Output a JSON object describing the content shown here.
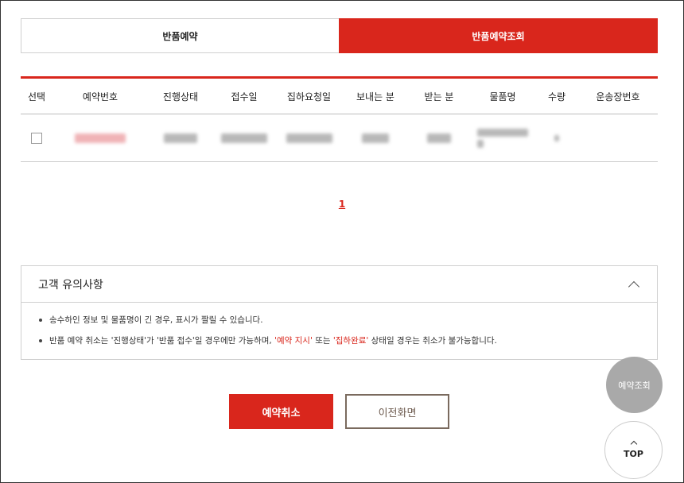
{
  "tabs": [
    {
      "label": "반품예약",
      "active": false
    },
    {
      "label": "반품예약조회",
      "active": true
    }
  ],
  "table": {
    "headers": [
      "선택",
      "예약번호",
      "진행상태",
      "접수일",
      "집하요청일",
      "보내는 분",
      "받는 분",
      "물품명",
      "수량",
      "운송장번호"
    ]
  },
  "pagination": {
    "current": "1"
  },
  "notice": {
    "title": "고객 유의사항",
    "items": {
      "first": "송수하인 정보 및 물품명이 긴 경우, 표시가 짤릴 수 있습니다.",
      "second_a": "반품 예약 취소는 '진행상태'가 '반품 접수'일 경우에만 가능하며, ",
      "second_red1": "'예약 지시'",
      "second_b": " 또는 ",
      "second_red2": "'집하완료'",
      "second_c": " 상태일 경우는 취소가 불가능합니다."
    }
  },
  "buttons": {
    "cancel": "예약취소",
    "prev": "이전화면"
  },
  "floating": {
    "reservation": "예약조회",
    "top": "TOP"
  },
  "colors": {
    "accent": "#d9261c",
    "prev_border": "#7a6a5e",
    "float_gray": "#a9a9a9"
  }
}
